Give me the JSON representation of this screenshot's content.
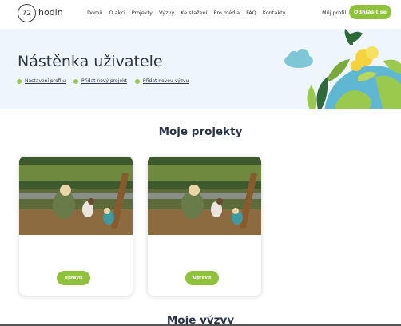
{
  "header": {
    "logo_number": "72",
    "logo_text": "hodin",
    "nav": [
      "Domů",
      "O akci",
      "Projekty",
      "Výzvy",
      "Ke stažení",
      "Pro média",
      "FAQ",
      "Kontakty"
    ],
    "my_profile": "Můj profil",
    "logout": "Odhlásit se"
  },
  "hero": {
    "title": "Nástěnka uživatele",
    "links": [
      "Nastavení profilu",
      "Přidat nový projekt",
      "Přidat novou výzvu"
    ]
  },
  "projects": {
    "title": "Moje projekty",
    "cards": [
      {
        "edit_label": "Upravit"
      },
      {
        "edit_label": "Upravit"
      }
    ]
  },
  "challenges": {
    "title": "Moje výzvy"
  },
  "colors": {
    "accent": "#8fc23a",
    "hero_bg": "#eef6fb",
    "heading": "#2b3547"
  }
}
